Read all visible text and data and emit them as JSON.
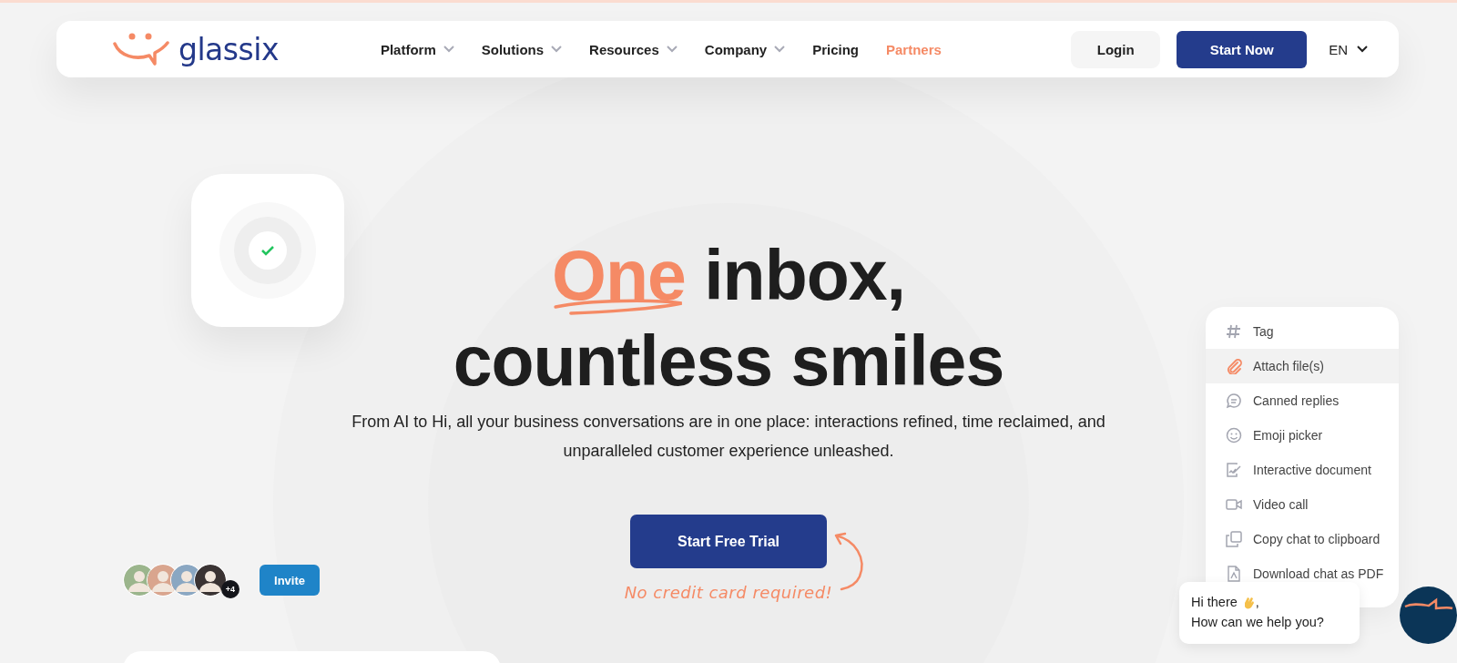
{
  "nav": {
    "logo": "glassix",
    "links": [
      {
        "label": "Platform",
        "dropdown": true,
        "accent": false
      },
      {
        "label": "Solutions",
        "dropdown": true,
        "accent": false
      },
      {
        "label": "Resources",
        "dropdown": true,
        "accent": false
      },
      {
        "label": "Company",
        "dropdown": true,
        "accent": false
      },
      {
        "label": "Pricing",
        "dropdown": false,
        "accent": false
      },
      {
        "label": "Partners",
        "dropdown": false,
        "accent": true
      }
    ],
    "login": "Login",
    "start": "Start Now",
    "language": "EN"
  },
  "hero": {
    "title_accent": "One",
    "title_rest": "inbox,",
    "title_line2": "countless smiles",
    "subtitle": "From AI to Hi, all your business conversations are in one place: interactions refined, time reclaimed, and unparalleled customer experience unleashed.",
    "cta": "Start Free Trial",
    "note": "No credit card required!"
  },
  "team": {
    "more": "+4",
    "invite": "Invite"
  },
  "actions_menu": [
    {
      "label": "Tag",
      "selected": false
    },
    {
      "label": "Attach file(s)",
      "selected": true
    },
    {
      "label": "Canned replies",
      "selected": false
    },
    {
      "label": "Emoji picker",
      "selected": false
    },
    {
      "label": "Interactive document",
      "selected": false
    },
    {
      "label": "Video call",
      "selected": false
    },
    {
      "label": "Copy chat to clipboard",
      "selected": false
    },
    {
      "label": "Download chat as PDF",
      "selected": false
    }
  ],
  "chat": {
    "greeting": "Hi there",
    "greeting_end": ",",
    "question": "How can we help you?"
  }
}
